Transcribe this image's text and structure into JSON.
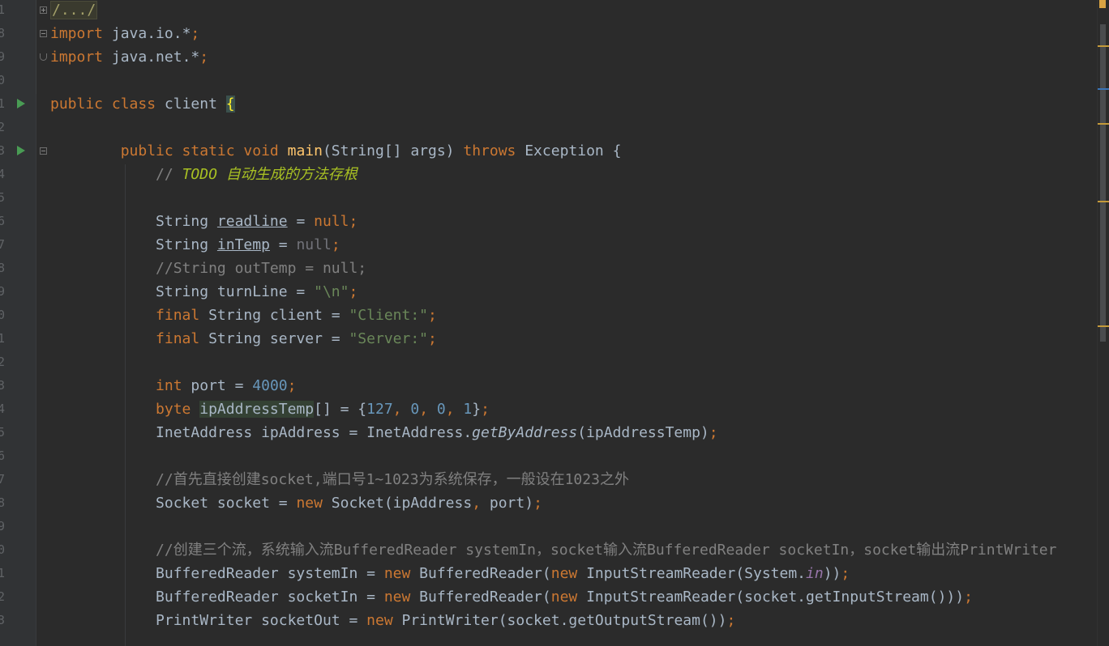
{
  "editor": {
    "line_numbers": [
      "1",
      "8",
      "9",
      "0",
      "1",
      "2",
      "3",
      "4",
      "5",
      "6",
      "7",
      "8",
      "9",
      "0",
      "1",
      "2",
      "3",
      "4",
      "5",
      "6",
      "7",
      "8",
      "9",
      "0",
      "1",
      "2",
      "3"
    ],
    "lines": [
      [
        {
          "t": "/.../",
          "c": "folded"
        }
      ],
      [
        {
          "t": "import",
          "c": "kw"
        },
        {
          "t": " java.io.*"
        },
        {
          "t": ";",
          "c": "kw"
        }
      ],
      [
        {
          "t": "import",
          "c": "kw"
        },
        {
          "t": " java.net.*"
        },
        {
          "t": ";",
          "c": "kw"
        }
      ],
      [],
      [
        {
          "t": "public class ",
          "c": "kw"
        },
        {
          "t": "client "
        },
        {
          "t": "{",
          "c": "brace-match"
        }
      ],
      [],
      [
        {
          "t": "        "
        },
        {
          "t": "public static void ",
          "c": "kw"
        },
        {
          "t": "main",
          "c": "fn"
        },
        {
          "t": "(String[] args) "
        },
        {
          "t": "throws ",
          "c": "kw"
        },
        {
          "t": "Exception {"
        }
      ],
      [
        {
          "t": "            "
        },
        {
          "t": "// ",
          "c": "cm"
        },
        {
          "t": "TODO 自动生成的方法存根",
          "c": "todo"
        }
      ],
      [],
      [
        {
          "t": "            String "
        },
        {
          "t": "readline",
          "c": "ul"
        },
        {
          "t": " = "
        },
        {
          "t": "null;",
          "c": "kw"
        }
      ],
      [
        {
          "t": "            String "
        },
        {
          "t": "inTemp",
          "c": "ul"
        },
        {
          "t": " = "
        },
        {
          "t": "null",
          "c": "grayed"
        },
        {
          "t": ";",
          "c": "kw"
        }
      ],
      [
        {
          "t": "            "
        },
        {
          "t": "//String outTemp = null;",
          "c": "cm"
        }
      ],
      [
        {
          "t": "            String turnLine = "
        },
        {
          "t": "\"\\n\"",
          "c": "str"
        },
        {
          "t": ";",
          "c": "kw"
        }
      ],
      [
        {
          "t": "            "
        },
        {
          "t": "final ",
          "c": "kw"
        },
        {
          "t": "String client = "
        },
        {
          "t": "\"Client:\"",
          "c": "str"
        },
        {
          "t": ";",
          "c": "kw"
        }
      ],
      [
        {
          "t": "            "
        },
        {
          "t": "final ",
          "c": "kw"
        },
        {
          "t": "String server = "
        },
        {
          "t": "\"Server:\"",
          "c": "str"
        },
        {
          "t": ";",
          "c": "kw"
        }
      ],
      [],
      [
        {
          "t": "            "
        },
        {
          "t": "int ",
          "c": "kw"
        },
        {
          "t": "port = "
        },
        {
          "t": "4000",
          "c": "num"
        },
        {
          "t": ";",
          "c": "kw"
        }
      ],
      [
        {
          "t": "            "
        },
        {
          "t": "byte ",
          "c": "kw"
        },
        {
          "t": "ipAddressTemp",
          "c": "hl-usage"
        },
        {
          "t": "[] = {"
        },
        {
          "t": "127",
          "c": "num"
        },
        {
          "t": ", ",
          "c": "kw"
        },
        {
          "t": "0",
          "c": "num"
        },
        {
          "t": ", ",
          "c": "kw"
        },
        {
          "t": "0",
          "c": "num"
        },
        {
          "t": ", ",
          "c": "kw"
        },
        {
          "t": "1",
          "c": "num"
        },
        {
          "t": "}"
        },
        {
          "t": ";",
          "c": "kw"
        }
      ],
      [
        {
          "t": "            InetAddress ipAddress = InetAddress."
        },
        {
          "t": "getByAddress",
          "c": "it"
        },
        {
          "t": "(ipAddressTemp)"
        },
        {
          "t": ";",
          "c": "kw"
        }
      ],
      [],
      [
        {
          "t": "            "
        },
        {
          "t": "//首先直接创建socket,端口号1~1023为系统保存，一般设在1023之外",
          "c": "cm"
        }
      ],
      [
        {
          "t": "            Socket socket = "
        },
        {
          "t": "new ",
          "c": "kw"
        },
        {
          "t": "Socket(ipAddress"
        },
        {
          "t": ", ",
          "c": "kw"
        },
        {
          "t": "port)"
        },
        {
          "t": ";",
          "c": "kw"
        }
      ],
      [],
      [
        {
          "t": "            "
        },
        {
          "t": "//创建三个流，系统输入流BufferedReader systemIn，socket输入流BufferedReader socketIn，socket输出流PrintWriter",
          "c": "cm"
        }
      ],
      [
        {
          "t": "            BufferedReader systemIn = "
        },
        {
          "t": "new ",
          "c": "kw"
        },
        {
          "t": "BufferedReader("
        },
        {
          "t": "new ",
          "c": "kw"
        },
        {
          "t": "InputStreamReader(System."
        },
        {
          "t": "in",
          "c": "static-field"
        },
        {
          "t": "))"
        },
        {
          "t": ";",
          "c": "kw"
        }
      ],
      [
        {
          "t": "            BufferedReader socketIn = "
        },
        {
          "t": "new ",
          "c": "kw"
        },
        {
          "t": "BufferedReader("
        },
        {
          "t": "new ",
          "c": "kw"
        },
        {
          "t": "InputStreamReader(socket.getInputStream()))"
        },
        {
          "t": ";",
          "c": "kw"
        }
      ],
      [
        {
          "t": "            PrintWriter socketOut = "
        },
        {
          "t": "new ",
          "c": "kw"
        },
        {
          "t": "PrintWriter(socket.getOutputStream())"
        },
        {
          "t": ";",
          "c": "kw"
        }
      ]
    ]
  },
  "gutter_icons": {
    "run_lines": [
      4,
      6
    ],
    "fold_open_lines": [
      1,
      6
    ],
    "fold_closed_lines": [
      0
    ],
    "fold_end_lines": [
      2
    ]
  },
  "colors": {
    "background": "#2b2b2b",
    "keyword": "#cc7832",
    "function": "#ffc66d",
    "string": "#6a8759",
    "number": "#6897bb",
    "comment": "#808080",
    "todo": "#a8c023"
  }
}
